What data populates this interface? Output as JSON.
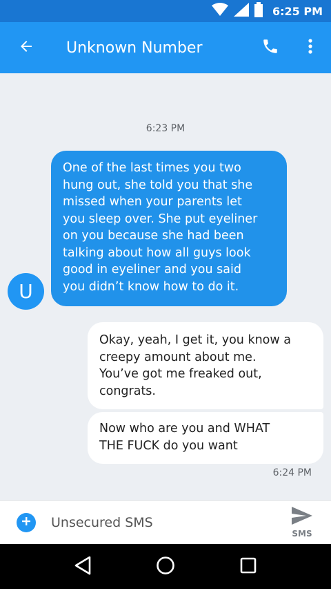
{
  "status_bar": {
    "time": "6:25 PM",
    "icons": [
      "wifi-icon",
      "signal-icon",
      "battery-icon"
    ]
  },
  "app_bar": {
    "title": "Unknown Number",
    "icons": [
      "arrow-back-icon",
      "phone-icon",
      "more-vert-icon"
    ]
  },
  "conversation": {
    "timestamp_top": "6:23 PM",
    "contact_initial": "U",
    "incoming_message": "One of the last times you two\nhung out, she told you that she\nmissed when your parents let\nyou sleep over. She put eyeliner\non you because she had been\ntalking about how all guys look\ngood in eyeliner and you said\nyou didn’t know how to do it.",
    "outgoing_messages": [
      "Okay, yeah, I get it, you know a\ncreepy amount about me.\nYou’ve got me freaked out,\ncongrats.",
      "Now who are you and WHAT\nTHE FUCK do you want"
    ],
    "timestamp_bottom": "6:24 PM"
  },
  "composer": {
    "placeholder": "Unsecured SMS",
    "send_label": "SMS",
    "icons": [
      "add-circle-icon",
      "send-icon"
    ]
  },
  "navigation_bar": {
    "icons": [
      "back-triangle-icon",
      "home-circle-icon",
      "recents-square-icon"
    ]
  },
  "colors": {
    "status_bar": "#1976d2",
    "app_bar": "#2196f3",
    "incoming_bubble": "#2192ea",
    "outgoing_bubble": "#ffffff",
    "background": "#eceff3"
  }
}
